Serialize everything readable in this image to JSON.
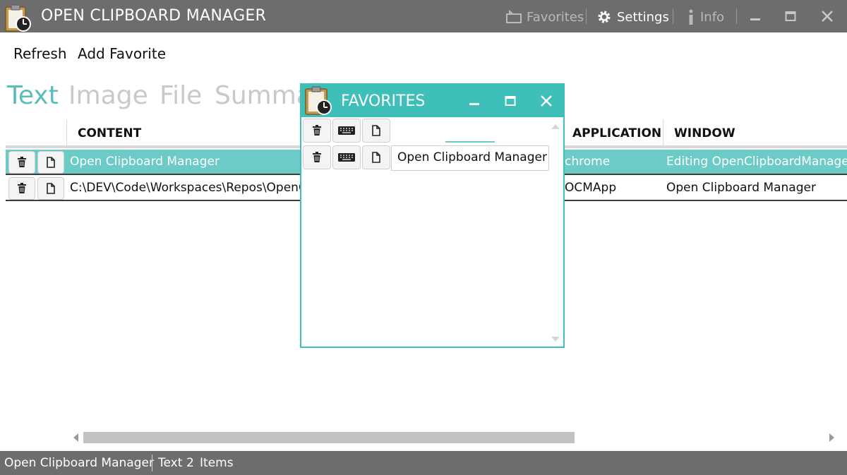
{
  "app": {
    "title": "OPEN CLIPBOARD MANAGER",
    "favorites_label": "Favorites",
    "settings_label": "Settings",
    "info_label": "Info"
  },
  "toolbar": {
    "refresh_label": "Refresh",
    "add_favorite_label": "Add Favorite"
  },
  "tabs": [
    {
      "label": "Text",
      "active": true
    },
    {
      "label": "Image",
      "active": false
    },
    {
      "label": "File",
      "active": false
    },
    {
      "label": "Summa",
      "active": false
    }
  ],
  "grid": {
    "columns": {
      "content": "CONTENT",
      "application": "APPLICATION",
      "window": "WINDOW"
    },
    "rows": [
      {
        "content": "Open Clipboard Manager",
        "application": "chrome",
        "window": "Editing OpenClipboardManage",
        "selected": true
      },
      {
        "content": "C:\\DEV\\Code\\Workspaces\\Repos\\OpenCl",
        "application": "OCMApp",
        "window": "Open Clipboard Manager",
        "selected": false
      }
    ]
  },
  "status": {
    "app_name": "Open Clipboard Manager",
    "type": "Text",
    "count": "2",
    "items_label": "Items"
  },
  "favorites_window": {
    "title": "FAVORITES",
    "entries": [
      {
        "value": ""
      },
      {
        "value": "Open Clipboard Manager"
      }
    ]
  },
  "colors": {
    "accent": "#5bbdb8",
    "selected_row": "#6ccbc6",
    "titlebar": "#6d6d6d",
    "favorites_titlebar": "#3fbfb9"
  },
  "icons": {
    "app_logo": "clipboard-clock-icon",
    "favorites": "favorites-star-icon",
    "settings": "gear-icon",
    "info": "info-icon",
    "delete": "trash-icon",
    "copy": "copy-icon",
    "keyboard": "keyboard-icon"
  }
}
